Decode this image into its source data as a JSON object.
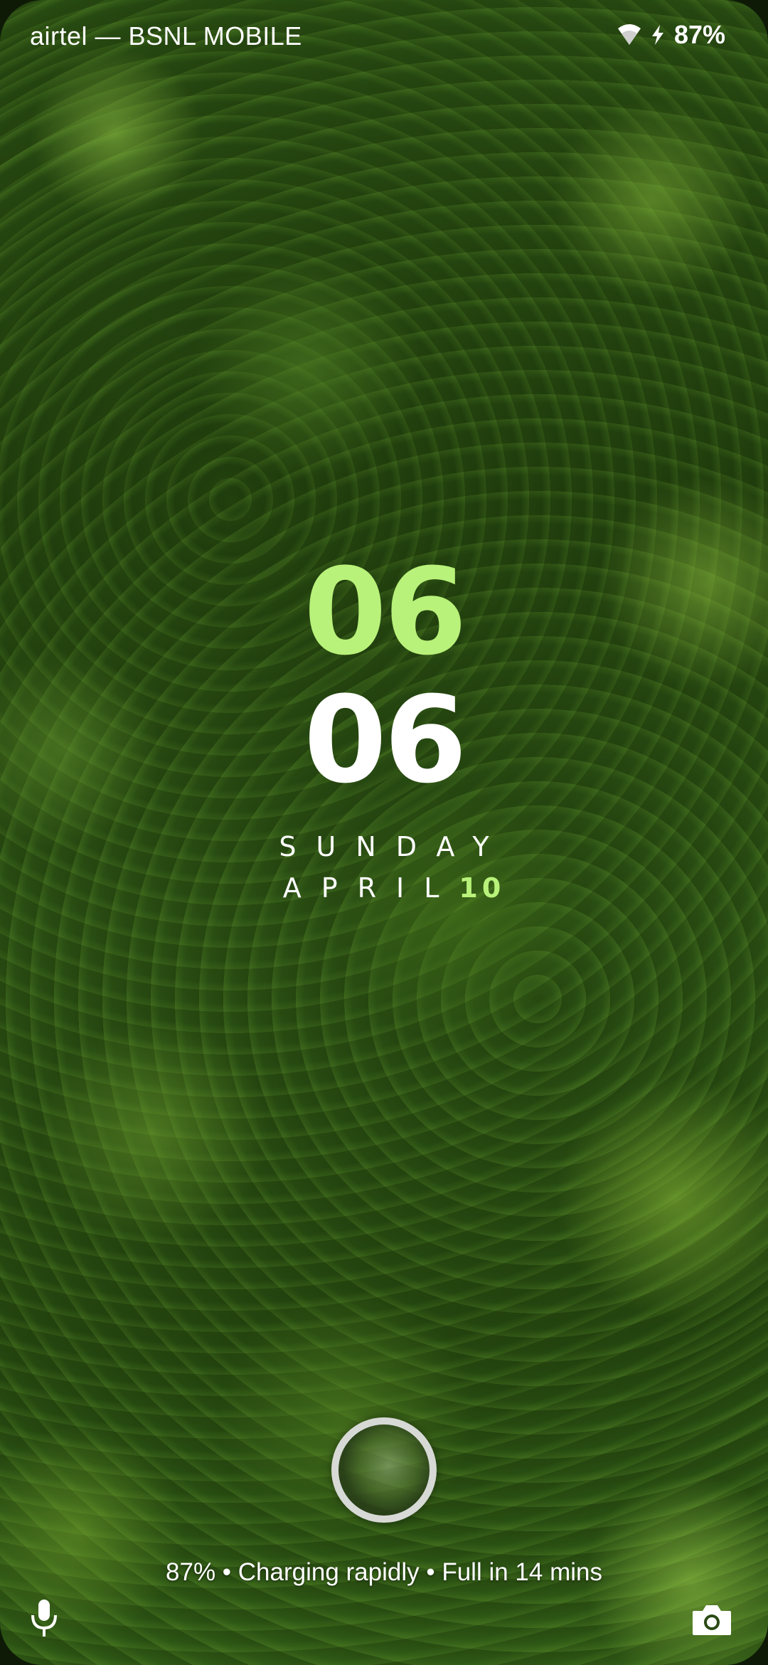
{
  "status_bar": {
    "carrier": "airtel — BSNL MOBILE",
    "battery_percent": "87%",
    "icons": [
      "wifi-icon",
      "charging-bolt-icon"
    ]
  },
  "clock": {
    "hour": "06",
    "minute": "06"
  },
  "date": {
    "day": "SUNDAY",
    "month": "APRIL",
    "day_number": "10"
  },
  "lock_screen": {
    "charging_status": "87% • Charging rapidly • Full in 14 mins",
    "left_shortcut": "mic-icon",
    "right_shortcut": "camera-icon",
    "center": "fingerprint-sensor"
  },
  "colors": {
    "accent": "#b9f27a",
    "text": "#ffffff"
  }
}
